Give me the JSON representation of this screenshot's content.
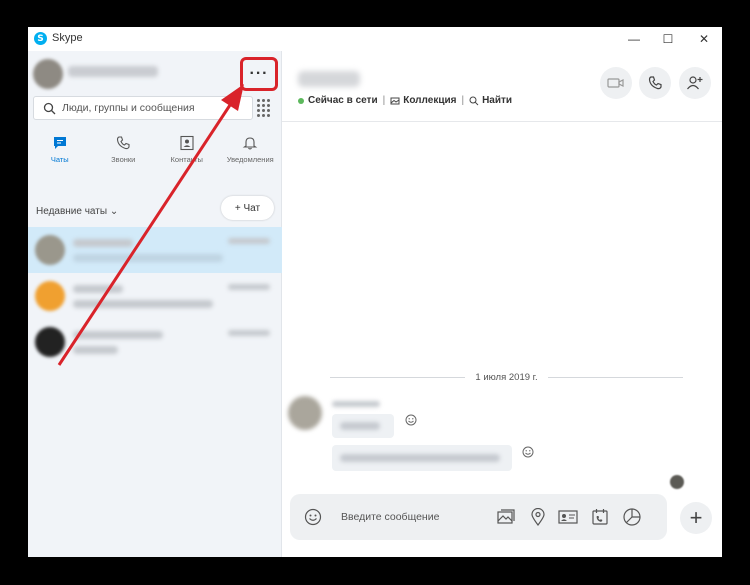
{
  "window": {
    "app_title": "Skype",
    "app_logo_letter": "S",
    "minimize": "—",
    "maximize": "☐",
    "close": "✕"
  },
  "sidebar": {
    "more_button": "···",
    "search": {
      "placeholder": "Люди, группы и сообщения"
    },
    "tabs": [
      {
        "label": "Чаты",
        "icon": "chat-icon",
        "active": true
      },
      {
        "label": "Звонки",
        "icon": "phone-icon",
        "active": false
      },
      {
        "label": "Контакты",
        "icon": "contacts-icon",
        "active": false
      },
      {
        "label": "Уведомления",
        "icon": "bell-icon",
        "active": false
      }
    ],
    "recent_header": "Недавние чаты",
    "new_chat_button": "+ Чат"
  },
  "conversation": {
    "status": "Сейчас в сети",
    "gallery": "Коллекция",
    "find": "Найти",
    "date_divider": "1 июля 2019 г.",
    "composer_placeholder": "Введите сообщение"
  },
  "colors": {
    "accent": "#0078d4",
    "annotation": "#d9232a",
    "selected_chat": "#d2eaf9",
    "online": "#5cb85c"
  }
}
